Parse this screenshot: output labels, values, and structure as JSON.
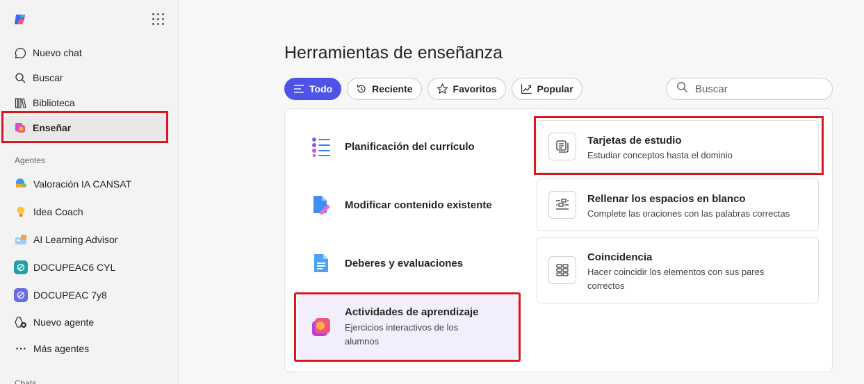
{
  "sidebar": {
    "nav": [
      {
        "label": "Nuevo chat",
        "icon": "chat-bubble-icon"
      },
      {
        "label": "Buscar",
        "icon": "search-icon"
      },
      {
        "label": "Biblioteca",
        "icon": "library-icon"
      },
      {
        "label": "Enseñar",
        "icon": "teach-icon"
      }
    ],
    "agents_label": "Agentes",
    "agents": [
      {
        "label": "Valoración IA CANSAT"
      },
      {
        "label": "Idea Coach"
      },
      {
        "label": "AI Learning Advisor"
      },
      {
        "label": "DOCUPEAC6 CYL"
      },
      {
        "label": "DOCUPEAC 7y8"
      },
      {
        "label": "Nuevo agente"
      },
      {
        "label": "Más agentes"
      }
    ],
    "chats_label": "Chats"
  },
  "main": {
    "title": "Herramientas de enseñanza",
    "filters": [
      "Todo",
      "Reciente",
      "Favoritos",
      "Popular"
    ],
    "search_placeholder": "Buscar",
    "categories": [
      {
        "title": "Planificación del currículo"
      },
      {
        "title": "Modificar contenido existente"
      },
      {
        "title": "Deberes y evaluaciones"
      },
      {
        "title": "Actividades de aprendizaje",
        "desc": "Ejercicios interactivos de los alumnos"
      }
    ],
    "tools": [
      {
        "title": "Tarjetas de estudio",
        "desc": "Estudiar conceptos hasta el dominio"
      },
      {
        "title": "Rellenar los espacios en blanco",
        "desc": "Complete las oraciones con las palabras correctas"
      },
      {
        "title": "Coincidencia",
        "desc": "Hacer coincidir los elementos con sus pares correctos"
      }
    ]
  },
  "colors": {
    "accent": "#4f52e6",
    "highlight": "#d9171f",
    "active_bg": "#f2eefc"
  }
}
